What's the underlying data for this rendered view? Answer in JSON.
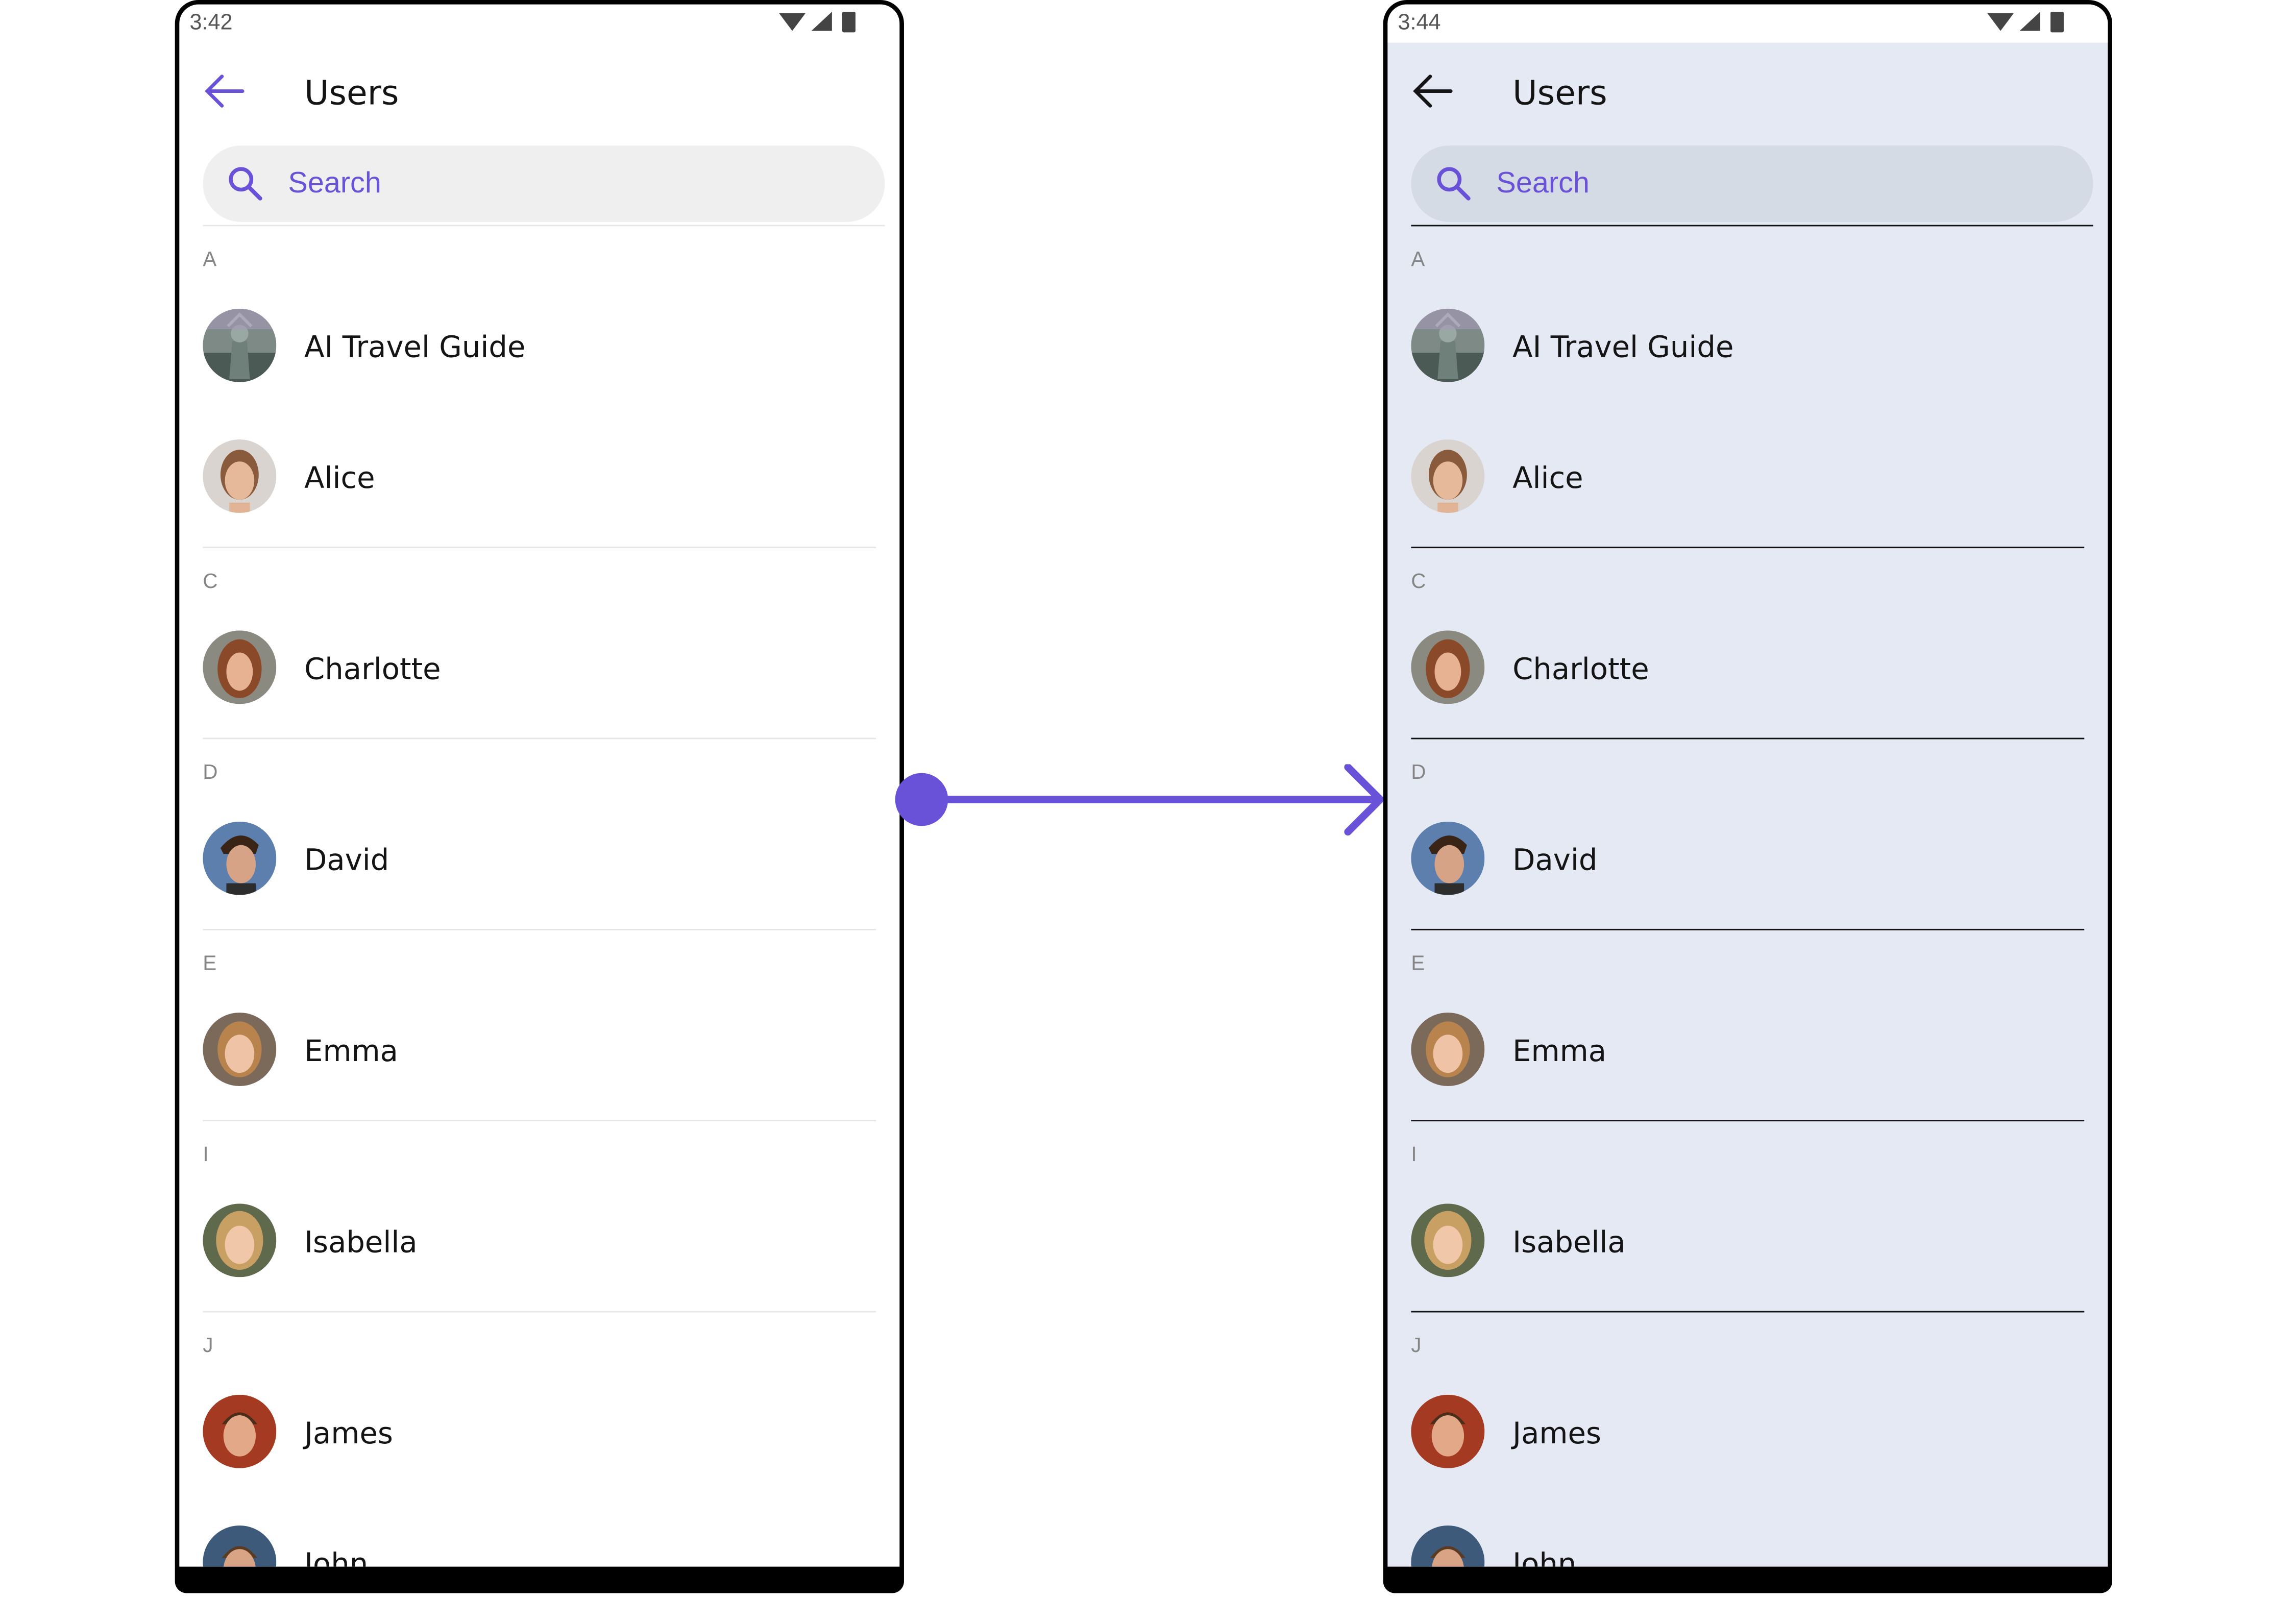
{
  "screens": [
    {
      "status_time": "3:42",
      "title": "Users",
      "search_placeholder": "Search",
      "sections": [
        {
          "letter": "A",
          "users": [
            "AI Travel Guide",
            "Alice"
          ]
        },
        {
          "letter": "C",
          "users": [
            "Charlotte"
          ]
        },
        {
          "letter": "D",
          "users": [
            "David"
          ]
        },
        {
          "letter": "E",
          "users": [
            "Emma"
          ]
        },
        {
          "letter": "I",
          "users": [
            "Isabella"
          ]
        },
        {
          "letter": "J",
          "users": [
            "James",
            "John"
          ]
        }
      ]
    },
    {
      "status_time": "3:44",
      "title": "Users",
      "search_placeholder": "Search",
      "sections": [
        {
          "letter": "A",
          "users": [
            "AI Travel Guide",
            "Alice"
          ]
        },
        {
          "letter": "C",
          "users": [
            "Charlotte"
          ]
        },
        {
          "letter": "D",
          "users": [
            "David"
          ]
        },
        {
          "letter": "E",
          "users": [
            "Emma"
          ]
        },
        {
          "letter": "I",
          "users": [
            "Isabella"
          ]
        },
        {
          "letter": "J",
          "users": [
            "James",
            "John"
          ]
        }
      ]
    }
  ],
  "colors": {
    "accent": "#6a52d8",
    "right_background": "#e4e9f4",
    "left_background": "#ffffff"
  },
  "icons": {
    "back": "arrow-left-icon",
    "search": "search-icon",
    "status": [
      "wifi-icon",
      "signal-icon",
      "battery-icon"
    ]
  }
}
